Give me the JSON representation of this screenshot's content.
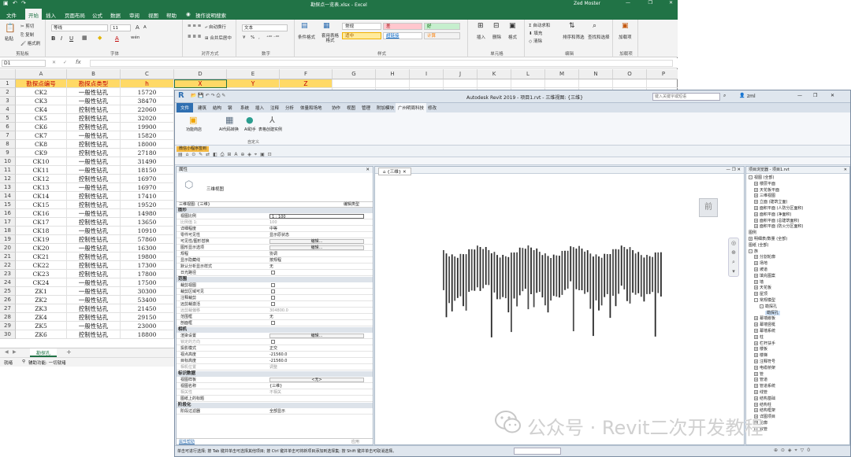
{
  "excel": {
    "title": "勘探点一览表.xlsx - Excel",
    "user": "Zed Moster",
    "tabs": [
      "文件",
      "开始",
      "插入",
      "页面布局",
      "公式",
      "数据",
      "审阅",
      "视图",
      "帮助",
      "操作说明搜索"
    ],
    "active_tab": "开始",
    "ribbon": {
      "clipboard": {
        "label": "剪贴板",
        "paste": "粘贴",
        "cut": "剪切",
        "copy": "复制",
        "format_painter": "格式刷"
      },
      "font": {
        "label": "字体",
        "font_name": "等线",
        "font_size": "11",
        "bold": "B",
        "italic": "I",
        "underline": "U",
        "grow": "A",
        "shrink": "A",
        "font_color": "A",
        "phonetic": "wén"
      },
      "alignment": {
        "label": "对齐方式",
        "wrap": "自动换行",
        "merge": "合并后居中"
      },
      "number": {
        "label": "数字",
        "format": "文本",
        "percent": "%",
        "comma": ","
      },
      "styles": {
        "label": "样式",
        "conditional": "条件格式",
        "table": "套用表格格式",
        "normal": "常规",
        "bad": "差",
        "good": "好",
        "neutral": "适中",
        "hyperlink": "超链接",
        "calc": "计算"
      },
      "cells": {
        "label": "单元格",
        "insert": "插入",
        "delete": "删除",
        "format": "格式"
      },
      "editing": {
        "label": "编辑",
        "autosum": "自动求和",
        "fill": "填充",
        "clear": "清除",
        "sort": "排序和筛选",
        "find": "查找和选择"
      },
      "addins": {
        "label": "加载项",
        "addin": "加载项"
      }
    },
    "name_box": "D1",
    "fx": "fx",
    "columns": [
      "A",
      "B",
      "C",
      "D",
      "E",
      "F",
      "G",
      "H",
      "I",
      "J",
      "K",
      "L",
      "M",
      "N",
      "O",
      "P"
    ],
    "header_row": [
      "勘探点编号",
      "勘探点类型",
      "h",
      "X",
      "Y",
      "Z"
    ],
    "rows": [
      [
        "CK2",
        "一般性钻孔",
        "15720"
      ],
      [
        "CK3",
        "一般性钻孔",
        "38470"
      ],
      [
        "CK4",
        "控制性钻孔",
        "22060"
      ],
      [
        "CK5",
        "控制性钻孔",
        "32020"
      ],
      [
        "CK6",
        "控制性钻孔",
        "19900"
      ],
      [
        "CK7",
        "一般性钻孔",
        "15820"
      ],
      [
        "CK8",
        "控制性钻孔",
        "18000"
      ],
      [
        "CK9",
        "控制性钻孔",
        "27180"
      ],
      [
        "CK10",
        "一般性钻孔",
        "31490"
      ],
      [
        "CK11",
        "一般性钻孔",
        "18150"
      ],
      [
        "CK12",
        "控制性钻孔",
        "16970"
      ],
      [
        "CK13",
        "一般性钻孔",
        "16970"
      ],
      [
        "CK14",
        "控制性钻孔",
        "17410"
      ],
      [
        "CK15",
        "控制性钻孔",
        "19520"
      ],
      [
        "CK16",
        "一般性钻孔",
        "14980"
      ],
      [
        "CK17",
        "控制性钻孔",
        "13650"
      ],
      [
        "CK18",
        "一般性钻孔",
        "10910"
      ],
      [
        "CK19",
        "控制性钻孔",
        "57860"
      ],
      [
        "CK20",
        "一般性钻孔",
        "16300"
      ],
      [
        "CK21",
        "控制性钻孔",
        "19800"
      ],
      [
        "CK22",
        "控制性钻孔",
        "17300"
      ],
      [
        "CK23",
        "控制性钻孔",
        "17800"
      ],
      [
        "CK24",
        "一般性钻孔",
        "17500"
      ],
      [
        "ZK1",
        "一般性钻孔",
        "30300"
      ],
      [
        "ZK2",
        "一般性钻孔",
        "53400"
      ],
      [
        "ZK3",
        "控制性钻孔",
        "21450"
      ],
      [
        "ZK4",
        "控制性钻孔",
        "29150"
      ],
      [
        "ZK5",
        "一般性钻孔",
        "23000"
      ],
      [
        "ZK6",
        "控制性钻孔",
        "18800"
      ]
    ],
    "row_numbers": [
      "1",
      "2",
      "3",
      "4",
      "5",
      "6",
      "7",
      "8",
      "9",
      "10",
      "11",
      "12",
      "13",
      "14",
      "15",
      "16",
      "17",
      "18",
      "19",
      "20",
      "21",
      "22",
      "23",
      "24",
      "25",
      "26",
      "27",
      "28",
      "29",
      "30"
    ],
    "sheet_tab": "勘探孔",
    "add_sheet": "+",
    "status_ready": "就绪",
    "status_access": "辅助功能: 一切就绪"
  },
  "revit": {
    "logo": "R",
    "title": "Autodesk Revit 2019 - 项目1.rvt - 三维视图: {三维}",
    "search_placeholder": "键入关键字或短语",
    "user": "zml",
    "tabs": [
      "文件",
      "建筑",
      "结构",
      "钢",
      "系统",
      "插入",
      "注释",
      "分析",
      "体量和场地",
      "协作",
      "视图",
      "管理",
      "附加模块",
      "广州明周科技",
      "修改"
    ],
    "active_tab": "广州明周科技",
    "ribbon_buttons": [
      "功能商店",
      "AI代码转换",
      "AI助手",
      "表格创建实例"
    ],
    "ribbon_panel_label": "自定义",
    "opts_label": "微信小程序签到",
    "properties": {
      "title": "属性",
      "type_name": "三维视图",
      "selector": "三维视图: {三维}",
      "edit_type": "编辑类型",
      "sections": {
        "graphics": "图形",
        "extents": "范围",
        "camera": "相机",
        "identity": "标识数据",
        "phasing": "阶段化"
      },
      "rows": {
        "scale": [
          "视图比例",
          "1 : 100"
        ],
        "scale_value": [
          "比例值 1:",
          "100"
        ],
        "detail": [
          "详细程度",
          "中等"
        ],
        "parts": [
          "零件可见性",
          "显示原状态"
        ],
        "vg": [
          "可见性/图形替换",
          "编辑..."
        ],
        "display": [
          "图形显示选项",
          "编辑..."
        ],
        "discipline": [
          "规程",
          "协调"
        ],
        "hidden": [
          "显示隐藏线",
          "按规程"
        ],
        "analysis": [
          "默认分析显示样式",
          "无"
        ],
        "sun": [
          "日光路径",
          ""
        ],
        "crop": [
          "裁剪视图",
          ""
        ],
        "crop_visible": [
          "裁剪区域可见",
          ""
        ],
        "annotation_crop": [
          "注释裁剪",
          ""
        ],
        "far_clip": [
          "远剪裁激活",
          ""
        ],
        "far_offset": [
          "远剪裁偏移",
          "304800.0"
        ],
        "scope_box": [
          "范围框",
          "无"
        ],
        "section_box": [
          "剖面框",
          ""
        ],
        "render": [
          "渲染设置",
          "编辑..."
        ],
        "lock": [
          "锁定的方向",
          ""
        ],
        "projection": [
          "投影模式",
          "正交"
        ],
        "eye": [
          "视点高度",
          "-21560.0"
        ],
        "target": [
          "目标高度",
          "-21560.0"
        ],
        "camera_pos": [
          "相机位置",
          "调整"
        ],
        "template": [
          "视图样板",
          "<无>"
        ],
        "view_name": [
          "视图名称",
          "{三维}"
        ],
        "dependency": [
          "相关性",
          "不相关"
        ],
        "title_sheet": [
          "图纸上的标题",
          ""
        ],
        "phase_filter": [
          "阶段过滤器",
          "全部显示"
        ]
      },
      "help": "属性帮助",
      "apply": "应用"
    },
    "view_tab": "{三维}",
    "view_cube_label": "前",
    "browser": {
      "title": "项目浏览器 - 项目1.rvt",
      "items": [
        {
          "t": "视图 (全部)",
          "lvl": 0,
          "ex": "-"
        },
        {
          "t": "楼层平面",
          "lvl": 1,
          "ex": "+"
        },
        {
          "t": "天花板平面",
          "lvl": 1,
          "ex": "+"
        },
        {
          "t": "三维视图",
          "lvl": 1,
          "ex": "+"
        },
        {
          "t": "立面 (建筑立面)",
          "lvl": 1,
          "ex": "+"
        },
        {
          "t": "面积平面 (人防分区面积)",
          "lvl": 1,
          "ex": "+"
        },
        {
          "t": "面积平面 (净面积)",
          "lvl": 1,
          "ex": "+"
        },
        {
          "t": "面积平面 (总建筑面积)",
          "lvl": 1,
          "ex": "+"
        },
        {
          "t": "面积平面 (防火分区面积)",
          "lvl": 1,
          "ex": "+"
        },
        {
          "t": "图例",
          "lvl": 0,
          "ex": ""
        },
        {
          "t": "明细表/数量 (全部)",
          "lvl": 0,
          "ex": "+"
        },
        {
          "t": "图纸 (全部)",
          "lvl": 0,
          "ex": ""
        },
        {
          "t": "族",
          "lvl": 0,
          "ex": "-"
        },
        {
          "t": "分割轮廓",
          "lvl": 1,
          "ex": "+"
        },
        {
          "t": "场地",
          "lvl": 1,
          "ex": "+"
        },
        {
          "t": "坡道",
          "lvl": 1,
          "ex": "+"
        },
        {
          "t": "填充图案",
          "lvl": 1,
          "ex": "+"
        },
        {
          "t": "墙",
          "lvl": 1,
          "ex": "+"
        },
        {
          "t": "天花板",
          "lvl": 1,
          "ex": "+"
        },
        {
          "t": "屋顶",
          "lvl": 1,
          "ex": "+"
        },
        {
          "t": "常规模型",
          "lvl": 1,
          "ex": "-"
        },
        {
          "t": "勘探孔",
          "lvl": 2,
          "ex": "-"
        },
        {
          "t": "勘探孔",
          "lvl": 3,
          "ex": ""
        },
        {
          "t": "幕墙嵌板",
          "lvl": 1,
          "ex": "+"
        },
        {
          "t": "幕墙竖梃",
          "lvl": 1,
          "ex": "+"
        },
        {
          "t": "幕墙系统",
          "lvl": 1,
          "ex": "+"
        },
        {
          "t": "柱",
          "lvl": 1,
          "ex": "+"
        },
        {
          "t": "栏杆扶手",
          "lvl": 1,
          "ex": "+"
        },
        {
          "t": "楼板",
          "lvl": 1,
          "ex": "+"
        },
        {
          "t": "楼梯",
          "lvl": 1,
          "ex": "+"
        },
        {
          "t": "注释符号",
          "lvl": 1,
          "ex": "+"
        },
        {
          "t": "电缆桥架",
          "lvl": 1,
          "ex": "+"
        },
        {
          "t": "管",
          "lvl": 1,
          "ex": "+"
        },
        {
          "t": "管道",
          "lvl": 1,
          "ex": "+"
        },
        {
          "t": "管道系统",
          "lvl": 1,
          "ex": "+"
        },
        {
          "t": "线管",
          "lvl": 1,
          "ex": "+"
        },
        {
          "t": "结构基础",
          "lvl": 1,
          "ex": "+"
        },
        {
          "t": "结构柱",
          "lvl": 1,
          "ex": "+"
        },
        {
          "t": "结构框架",
          "lvl": 1,
          "ex": "+"
        },
        {
          "t": "详图项目",
          "lvl": 1,
          "ex": "+"
        },
        {
          "t": "轮廓",
          "lvl": 1,
          "ex": "+"
        },
        {
          "t": "软管",
          "lvl": 1,
          "ex": "+"
        }
      ]
    },
    "status": "单击可进行选择; 按 Tab 键并单击可选择其他项目; 按 Ctrl 键并单击可将新项目添加到选择集; 按 Shift 键并单击可取消选择。"
  },
  "watermark": "公众号 · Revit二次开发教程",
  "colors": {
    "excel_green": "#217346",
    "header_yellow": "#ffd966",
    "header_text": "#c00000",
    "revit_blue": "#2f6fb1"
  }
}
